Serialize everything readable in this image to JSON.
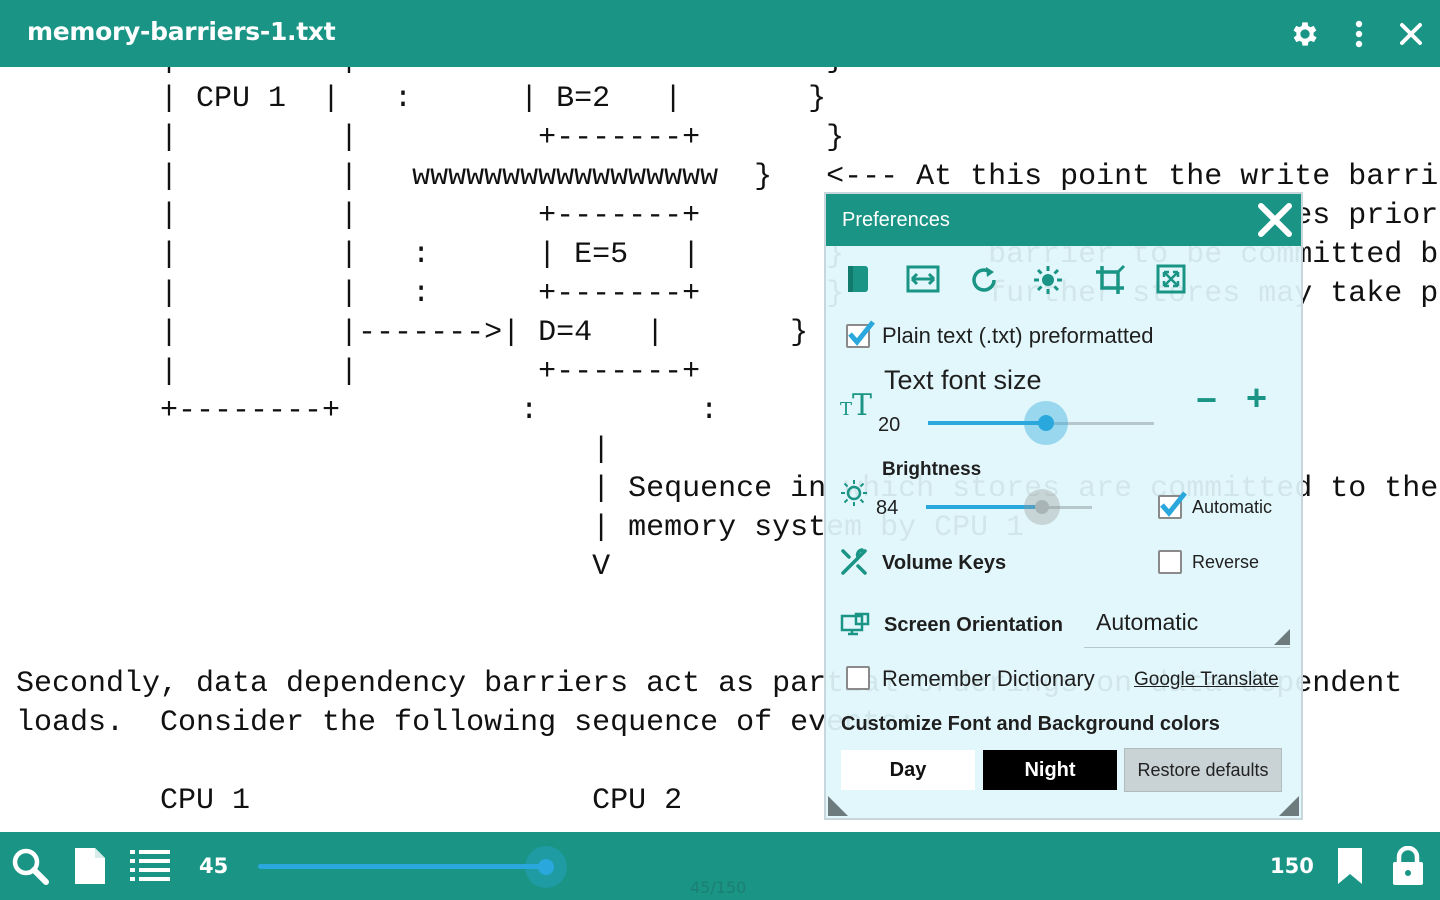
{
  "app": {
    "title": "memory-barriers-1.txt",
    "accent": "#1a9485",
    "slider_color": "#2aa8dd"
  },
  "topbar": {
    "icons": [
      "gear-icon",
      "more-vert-icon",
      "close-icon"
    ]
  },
  "document": {
    "text": "        |         |   :      +-------+       }\n        | CPU 1  |   :      | B=2   |       }\n        |         |          +-------+       }\n        |         |   wwwwwwwwwwwwwwwww  }   <--- At this point the write barrier\n        |         |          +-------+       }        requires all stores prior to the\n        |         |   :      | E=5   |       }        barrier to be committed before\n        |         |   :      +-------+       }        further stores may take place\n        |         |------->| D=4   |       }\n        |         |          +-------+\n        +--------+          :         :\n                                |\n                                | Sequence in which stores are committed to the\n                                | memory system by CPU 1\n                                V\n\n\nSecondly, data dependency barriers act as partial orderings on data-dependent\nloads.  Consider the following sequence of events:\n\n        CPU 1                   CPU 2\n        ======================= ======================="
  },
  "prefs": {
    "title": "Preferences",
    "tool_icons": [
      "book-icon",
      "fit-width-icon",
      "rotate-icon",
      "brightness-icon",
      "crop-icon",
      "fullscreen-icon"
    ],
    "plain_text_label": "Plain text (.txt) preformatted",
    "plain_text_checked": true,
    "font_size_label": "Text font size",
    "font_size_value": "20",
    "font_size_fraction": 0.52,
    "minus_label": "−",
    "plus_label": "+",
    "brightness_label": "Brightness",
    "brightness_value": "84",
    "brightness_fraction": 0.7,
    "automatic_label": "Automatic",
    "automatic_checked": true,
    "volume_keys_label": "Volume Keys",
    "reverse_label": "Reverse",
    "reverse_checked": false,
    "orientation_label": "Screen Orientation",
    "orientation_value": "Automatic",
    "remember_dict_label": "Remember Dictionary",
    "remember_dict_checked": false,
    "dictionary_link": "Google Translate",
    "customize_label": "Customize Font and Background colors",
    "day_label": "Day",
    "night_label": "Night",
    "restore_label": "Restore defaults"
  },
  "bottombar": {
    "current_page": "45",
    "total_pages": "150",
    "page_indicator": "45/150",
    "progress_fraction": 0.3,
    "icons": [
      "search-icon",
      "file-icon",
      "list-icon",
      "bookmark-icon",
      "lock-icon"
    ]
  }
}
